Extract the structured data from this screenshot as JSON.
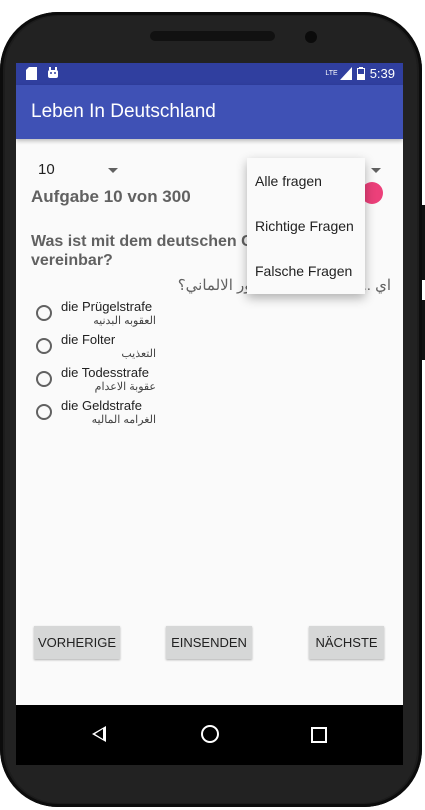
{
  "status_bar": {
    "time": "5:39",
    "network": "LTE",
    "icons": [
      "sd-card-icon",
      "android-icon",
      "signal-icon",
      "battery-icon"
    ]
  },
  "app_bar": {
    "title": "Leben In Deutschland"
  },
  "spinner_question": {
    "selected": "10"
  },
  "counter": "Aufgabe 10 von 300",
  "question": {
    "german": "Was ist mit dem deutschen G... vereinbar?",
    "german_visible_line1": "Was ist mit dem deutschen G",
    "german_visible_line2": "vereinbar?",
    "arabic": "اي ... متوافق مع الدستور الالماني؟"
  },
  "answers": [
    {
      "german": "die Prügelstrafe",
      "arabic": "العقوبه البدنيه"
    },
    {
      "german": "die Folter",
      "arabic": "التعذيب"
    },
    {
      "german": "die Todesstrafe",
      "arabic": "عقوبة الاعدام"
    },
    {
      "german": "die Geldstrafe",
      "arabic": "الغرامه الماليه"
    }
  ],
  "buttons": {
    "previous": "VORHERIGE",
    "submit": "EINSENDEN",
    "next": "NÄCHSTE"
  },
  "filter_dropdown": {
    "options": [
      "Alle fragen",
      "Richtige Fragen",
      "Falsche Fragen"
    ]
  },
  "colors": {
    "status_bar": "#303f9f",
    "app_bar": "#3f51b5",
    "accent": "#ec407a",
    "button": "#d6d7d7"
  }
}
